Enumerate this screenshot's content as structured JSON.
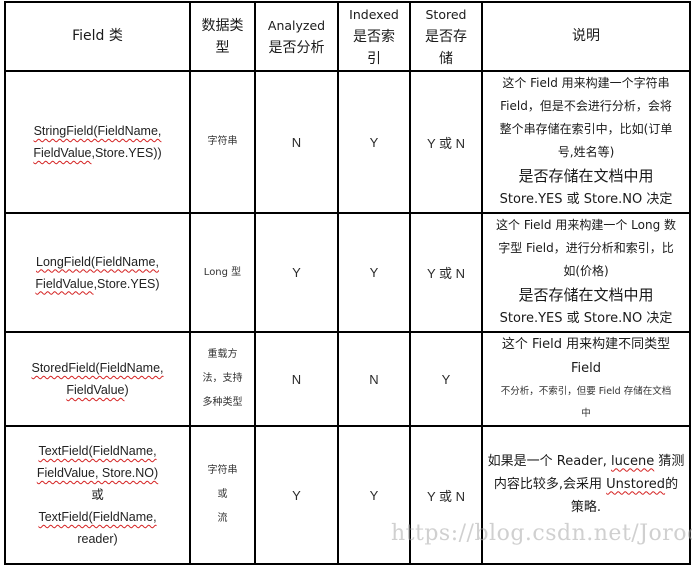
{
  "table": {
    "headers": {
      "field_class": "Field 类",
      "data_type": [
        "数据类",
        "型"
      ],
      "analyzed": [
        "Analyzed",
        "是否分析"
      ],
      "indexed": [
        "Indexed",
        "是否索",
        "引"
      ],
      "stored": [
        "Stored",
        "是否存",
        "储"
      ],
      "description": "说明"
    },
    "rows": [
      {
        "field_class": [
          [
            "StringField(FieldName,",
            true
          ],
          [
            "FieldValue",
            true
          ],
          [
            ",Store.YES))",
            false
          ]
        ],
        "data_type": [
          "字符串"
        ],
        "analyzed": "N",
        "indexed": "Y",
        "stored": "Y 或 N",
        "description": {
          "lines": [
            "这个 Field 用来构建一个字符串",
            "Field，但是不会进行分析，会将",
            "整个串存储在索引中，比如(订单",
            "号,姓名等)"
          ],
          "emphasis": [
            "是否存储在文档中用",
            "Store.YES 或 Store.NO 决定"
          ]
        }
      },
      {
        "field_class": [
          [
            "LongField(FieldName,",
            true
          ],
          [
            "FieldValue",
            true
          ],
          [
            ",Store.YES)",
            false
          ]
        ],
        "data_type": [
          "Long 型"
        ],
        "analyzed": "Y",
        "indexed": "Y",
        "stored": "Y 或 N",
        "description": {
          "lines": [
            "这个 Field 用来构建一个 Long 数",
            "字型 Field，进行分析和索引，比",
            "如(价格)"
          ],
          "emphasis": [
            "是否存储在文档中用",
            "Store.YES 或 Store.NO 决定"
          ]
        }
      },
      {
        "field_class": [
          [
            "StoredField(FieldName,",
            true
          ],
          [
            "FieldValue",
            true
          ],
          [
            ")",
            false
          ]
        ],
        "data_type": [
          "重载方",
          "法，支持",
          "多种类型"
        ],
        "analyzed": "N",
        "indexed": "N",
        "stored": "Y",
        "description": {
          "lines": [
            "这个 Field 用来构建不同类型",
            "Field"
          ],
          "small": [
            "不分析，不索引，但要 Field 存储在文档",
            "中"
          ]
        }
      },
      {
        "field_class_lines": [
          "TextField(FieldName,",
          "FieldValue, Store.NO)",
          "或",
          "TextField(FieldName,",
          "reader)"
        ],
        "data_type": [
          "字符串",
          "或",
          "流"
        ],
        "analyzed": "Y",
        "indexed": "Y",
        "stored": "Y 或 N",
        "description": {
          "parts": [
            "如果是一个 Reader, ",
            "lucene",
            " 猜测",
            "内容比较多,会采用 ",
            "Unstored",
            "的",
            "策略."
          ]
        }
      }
    ]
  },
  "watermark": "https://blog.csdn.net/Jorocco",
  "colors": {
    "border": "#000000",
    "spellcheck_underline": "#d42020",
    "watermark": "#aaaaaa"
  }
}
